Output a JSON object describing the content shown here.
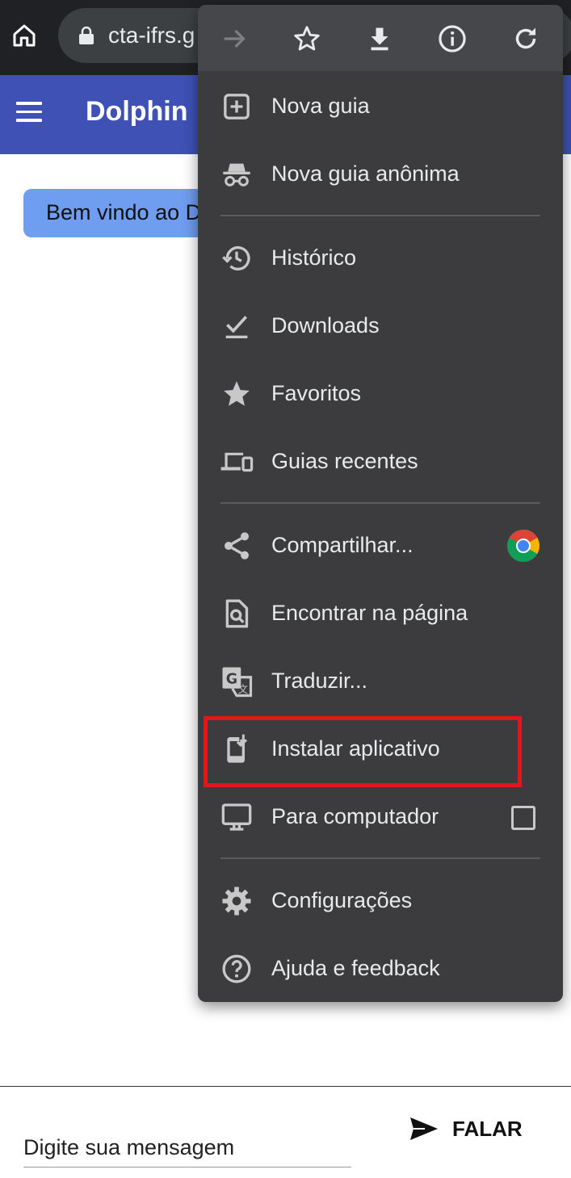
{
  "browser": {
    "url": "cta-ifrs.g",
    "icons": [
      "home-icon",
      "lock-icon"
    ]
  },
  "app": {
    "title": "Dolphin",
    "icons": [
      "hamburger-menu-icon"
    ]
  },
  "chat": {
    "welcome_message": "Bem vindo ao D"
  },
  "composer": {
    "placeholder": "Digite sua mensagem",
    "send_label": "FALAR",
    "icons": [
      "send-icon"
    ]
  },
  "menu": {
    "toolbar_icons": [
      "forward-arrow-icon",
      "star-outline-icon",
      "download-icon",
      "info-icon",
      "reload-icon"
    ],
    "items": [
      {
        "label": "Nova guia",
        "icon": "new-tab-icon"
      },
      {
        "label": "Nova guia anônima",
        "icon": "incognito-icon"
      },
      {
        "label": "Histórico",
        "icon": "history-icon"
      },
      {
        "label": "Downloads",
        "icon": "downloads-check-icon"
      },
      {
        "label": "Favoritos",
        "icon": "star-filled-icon"
      },
      {
        "label": "Guias recentes",
        "icon": "devices-icon"
      },
      {
        "label": "Compartilhar...",
        "icon": "share-icon",
        "badge": "chrome-logo-icon"
      },
      {
        "label": "Encontrar na página",
        "icon": "find-in-page-icon"
      },
      {
        "label": "Traduzir...",
        "icon": "translate-icon"
      },
      {
        "label": "Instalar aplicativo",
        "icon": "install-app-icon",
        "highlighted": true
      },
      {
        "label": "Para computador",
        "icon": "desktop-icon",
        "checkbox_checked": false
      },
      {
        "label": "Configurações",
        "icon": "settings-gear-icon"
      },
      {
        "label": "Ajuda e feedback",
        "icon": "help-icon"
      }
    ],
    "highlight_color": "#e4161b"
  },
  "colors": {
    "app_header": "#3f51b5",
    "bubble": "#6f9df0",
    "menu_bg": "#3c3c3e",
    "browser_bar": "#202124"
  }
}
